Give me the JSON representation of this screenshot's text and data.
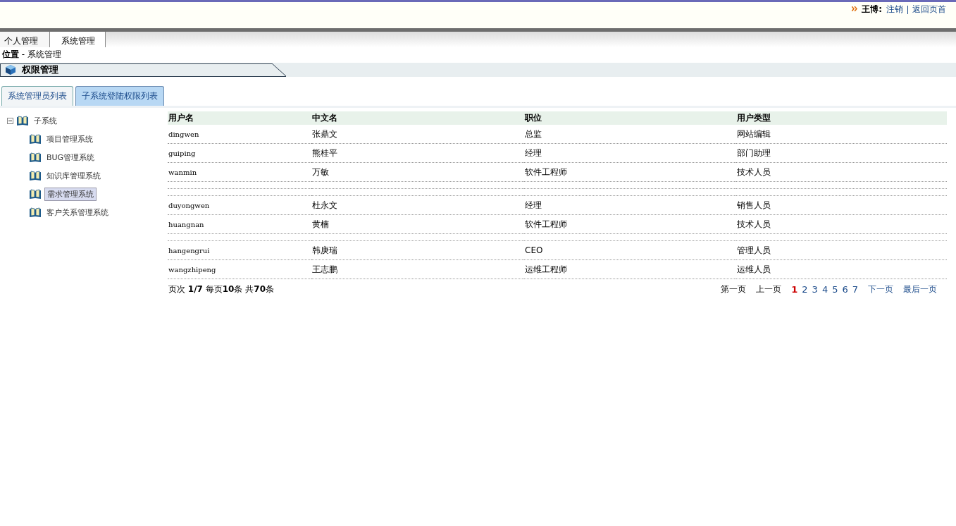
{
  "header": {
    "user": "王博:",
    "links": [
      "注销",
      "返回页首"
    ]
  },
  "menu": [
    {
      "label": "个人管理",
      "selected": false
    },
    {
      "label": "系统管理",
      "selected": true
    }
  ],
  "breadcrumb": {
    "label": "位置",
    "path": "- 系统管理"
  },
  "section_title": "权限管理",
  "tabs": [
    {
      "label": "系统管理员列表",
      "selected": false
    },
    {
      "label": "子系统登陆权限列表",
      "selected": true
    }
  ],
  "tree": {
    "label": "子系统",
    "expanded": true,
    "children": [
      {
        "label": "项目管理系统",
        "selected": false
      },
      {
        "label": "BUG管理系统",
        "selected": false
      },
      {
        "label": "知识库管理系统",
        "selected": false
      },
      {
        "label": "需求管理系统",
        "selected": true
      },
      {
        "label": "客户关系管理系统",
        "selected": false
      }
    ]
  },
  "table": {
    "columns": [
      "用户名",
      "中文名",
      "职位",
      "用户类型"
    ],
    "rows": [
      {
        "kind": "data",
        "cells": [
          "dingwen",
          "张鼎文",
          "总监",
          "网站编辑"
        ]
      },
      {
        "kind": "data",
        "cells": [
          "guiping",
          "熊桂平",
          "经理",
          "部门助理"
        ]
      },
      {
        "kind": "data",
        "cells": [
          "wanmin",
          "万敏",
          "软件工程师",
          "技术人员"
        ]
      },
      {
        "kind": "blank"
      },
      {
        "kind": "blank"
      },
      {
        "kind": "data",
        "cells": [
          "duyongwen",
          "杜永文",
          "经理",
          "销售人员"
        ]
      },
      {
        "kind": "data",
        "cells": [
          "huangnan",
          "黄楠",
          "软件工程师",
          "技术人员"
        ]
      },
      {
        "kind": "blank"
      },
      {
        "kind": "data",
        "cells": [
          "hangengrui",
          "韩庚瑞",
          "CEO",
          "管理人员"
        ]
      },
      {
        "kind": "data",
        "cells": [
          "wangzhipeng",
          "王志鹏",
          "运维工程师",
          "运维人员"
        ]
      }
    ]
  },
  "pager": {
    "summary": "页次 **1/7** 每页**10**条 共**70**条",
    "first": "第一页",
    "prev": "上一页",
    "pages": [
      {
        "label": "1",
        "selected": true
      },
      {
        "label": "2",
        "selected": false
      },
      {
        "label": "3",
        "selected": false
      },
      {
        "label": "4",
        "selected": false
      },
      {
        "label": "5",
        "selected": false
      },
      {
        "label": "6",
        "selected": false
      },
      {
        "label": "7",
        "selected": false
      }
    ],
    "next": "下一页",
    "last": "最后一页"
  }
}
